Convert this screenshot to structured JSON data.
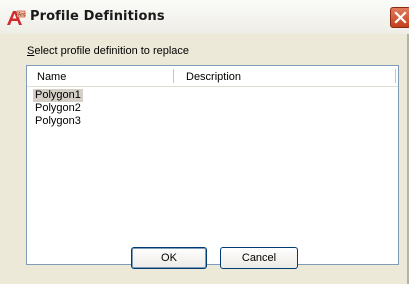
{
  "window": {
    "title": "Profile Definitions",
    "close_icon": "close-icon",
    "app_icon": "autocad-architecture-icon"
  },
  "dialog": {
    "prompt_label": "Select profile definition to replace",
    "prompt_mnemonic_char": "S",
    "prompt_rest": "elect profile definition to replace"
  },
  "list": {
    "columns": [
      {
        "label": "Name"
      },
      {
        "label": "Description"
      }
    ],
    "rows": [
      {
        "name": "Polygon1",
        "description": "",
        "selected": true
      },
      {
        "name": "Polygon2",
        "description": "",
        "selected": false
      },
      {
        "name": "Polygon3",
        "description": "",
        "selected": false
      }
    ]
  },
  "buttons": {
    "ok_label": "OK",
    "cancel_label": "Cancel"
  },
  "colors": {
    "dialog_bg": "#ece9d8",
    "list_border": "#7f9db9",
    "close_button": "#c2401d",
    "selection_bg": "#d4d0c8"
  }
}
